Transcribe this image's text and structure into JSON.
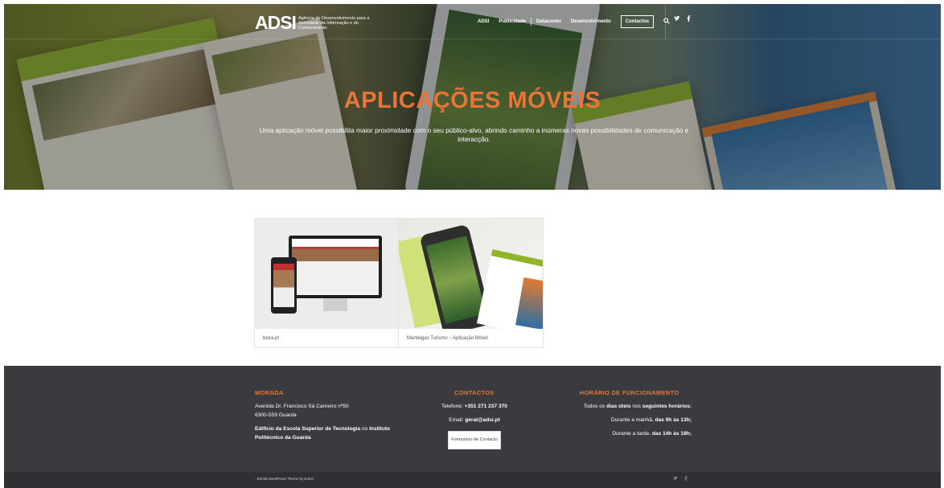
{
  "header": {
    "logo_mark": "ADSI",
    "logo_text": "Agência de Desenvolvimento para a Sociedade da Informação e do Conhecimento",
    "nav": [
      "ADSI",
      "Publicidade",
      "Datacenter",
      "Desenvolvimento"
    ],
    "contact_label": "Contactos",
    "search_icon": "search-icon",
    "social": {
      "twitter": "twitter-icon",
      "facebook": "facebook-icon"
    }
  },
  "hero": {
    "title": "APLICAÇÕES MÓVEIS",
    "subtitle": "Uma aplicação móvel possibilita maior proximidade com o seu público-alvo, abrindo caminho a inúmeras novas possibilidades de comunicação e interacção."
  },
  "portfolio": {
    "items": [
      {
        "caption": "beira.pt"
      },
      {
        "caption": "Manteigas Turismo – Aplicação Móvel"
      }
    ]
  },
  "footer": {
    "morada": {
      "heading": "MORADA",
      "line1": "Avenida Dr. Francisco Sá Carneiro nº50",
      "line2": "6300-559 Guarda",
      "building_bold": "Edifício da Escola Superior de Tecnologia",
      "building_mid": " no ",
      "building_bold2": "Instituto Politécnico da Guarda"
    },
    "contactos": {
      "heading": "CONTACTOS",
      "phone_label": "Telefone: ",
      "phone": "+351 271 237 370",
      "email_label": "Email: ",
      "email": "geral@adsi.pt",
      "form_button": "Formulário de Contacto"
    },
    "horario": {
      "heading": "HORÁRIO DE FUNCIONAMENTO",
      "intro_a": "Todos os ",
      "intro_b": "dias úteis",
      "intro_c": " nos ",
      "intro_d": "seguintes horários:",
      "morning_a": "Durante a manhã, ",
      "morning_b": "das 9h às 13h;",
      "afternoon_a": "Durante a tarde, ",
      "afternoon_b": "das 14h às 18h;"
    }
  },
  "socket": {
    "copyright": "- Enfold WordPress Theme by Kriesi",
    "social": {
      "twitter": "twitter-icon",
      "facebook": "facebook-icon"
    }
  },
  "colors": {
    "accent": "#e8743a",
    "footer_bg": "#393b3e",
    "socket_bg": "#2e3033",
    "green": "#8fb62a"
  }
}
